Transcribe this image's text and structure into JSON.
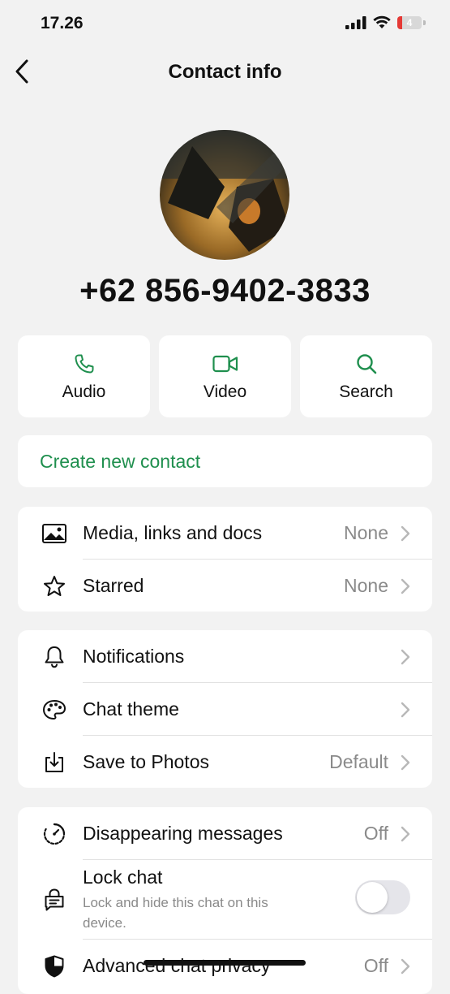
{
  "status_bar": {
    "time": "17.26",
    "battery_level": "4"
  },
  "nav": {
    "title": "Contact info"
  },
  "profile": {
    "phone": "+62 856-9402-3833"
  },
  "actions": [
    {
      "label": "Audio",
      "icon": "phone-icon"
    },
    {
      "label": "Video",
      "icon": "video-icon"
    },
    {
      "label": "Search",
      "icon": "search-icon"
    }
  ],
  "create_contact": {
    "label": "Create new contact"
  },
  "media_section": [
    {
      "label": "Media, links and docs",
      "value": "None",
      "icon": "image-icon"
    },
    {
      "label": "Starred",
      "value": "None",
      "icon": "star-icon"
    }
  ],
  "settings_section": [
    {
      "label": "Notifications",
      "value": "",
      "icon": "bell-icon"
    },
    {
      "label": "Chat theme",
      "value": "",
      "icon": "palette-icon"
    },
    {
      "label": "Save to Photos",
      "value": "Default",
      "icon": "download-icon"
    }
  ],
  "privacy_section": {
    "disappearing": {
      "label": "Disappearing messages",
      "value": "Off",
      "icon": "timer-icon"
    },
    "lock_chat": {
      "label": "Lock chat",
      "subtitle": "Lock and hide this chat on this device.",
      "enabled": false,
      "icon": "lock-chat-icon"
    },
    "advanced": {
      "label": "Advanced chat privacy",
      "value": "Off",
      "icon": "shield-icon"
    }
  },
  "colors": {
    "accent": "#1f8f4e",
    "background": "#f2f2f2",
    "card": "#ffffff",
    "secondary_text": "#8a8a8a"
  }
}
